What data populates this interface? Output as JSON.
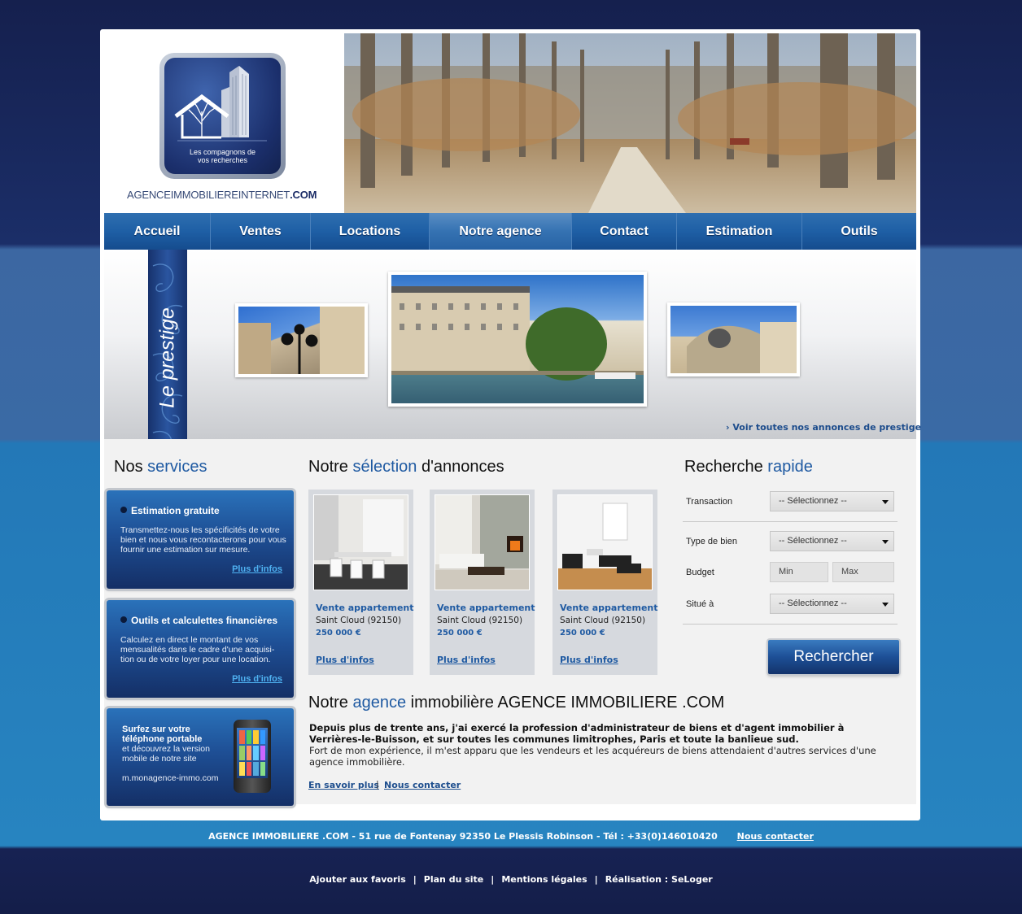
{
  "logo": {
    "tagline_line1": "Les compagnons de",
    "tagline_line2": "vos recherches",
    "site_name_part1": "AGENCEIMMOBILIEREINTERNET",
    "site_name_part2": ".COM"
  },
  "nav": {
    "items": [
      "Accueil",
      "Ventes",
      "Locations",
      "Notre agence",
      "Contact",
      "Estimation",
      "Outils"
    ],
    "active": "Notre agence"
  },
  "prestige": {
    "ribbon_label": "Le prestige",
    "link": "› Voir toutes nos annonces de prestige"
  },
  "services": {
    "title_part1": "Nos",
    "title_part2": "services",
    "items": [
      {
        "title": "Estimation gratuite",
        "text": "Transmettez-nous les spécificités de votre bien et nous vous recontacterons pour vous fournir une estimation sur mesure.",
        "link": "Plus d'infos"
      },
      {
        "title": "Outils et calculettes financières",
        "text": "Calculez en direct le montant de vos mensualités dans le cadre d'une acquisi-tion ou de votre loyer pour une location.",
        "link": "Plus d'infos"
      }
    ],
    "mobile": {
      "title_line1": "Surfez sur votre",
      "title_line2": "téléphone portable",
      "text_line1": "et découvrez la version",
      "text_line2": "mobile de notre site",
      "url": "m.monagence-immo.com"
    }
  },
  "selection": {
    "title_part1": "Notre",
    "title_part2": "sélection",
    "title_part3": "d'annonces",
    "cards": [
      {
        "title": "Vente appartement",
        "location": "Saint Cloud  (92150)",
        "price": "250 000 €",
        "link": "Plus d'infos"
      },
      {
        "title": "Vente appartement",
        "location": "Saint Cloud  (92150)",
        "price": "250 000 €",
        "link": "Plus d'infos"
      },
      {
        "title": "Vente appartement",
        "location": "Saint Cloud  (92150)",
        "price": "250 000 €",
        "link": "Plus d'infos"
      }
    ]
  },
  "search": {
    "title_part1": "Recherche",
    "title_part2": "rapide",
    "transaction_label": "Transaction",
    "transaction_value": "-- Sélectionnez --",
    "type_label": "Type de bien",
    "type_value": "-- Sélectionnez --",
    "budget_label": "Budget",
    "budget_min_placeholder": "Min",
    "budget_max_placeholder": "Max",
    "location_label": "Situé à",
    "location_value": "-- Sélectionnez --",
    "button": "Rechercher"
  },
  "agency": {
    "title_part1": "Notre",
    "title_part2": "agence",
    "title_part3": "immobilière AGENCE IMMOBILIERE .COM",
    "bold_text": "Depuis plus de trente ans, j'ai exercé la profession d'administrateur de biens et d'agent immobilier à Verrières-le-Buisson, et sur toutes les communes limitrophes, Paris et toute la banlieue sud.",
    "text": "Fort de mon expérience, il m'est apparu que les vendeurs et les acquéreurs de biens attendaient d'autres services d'une agence immobilière.",
    "link_more": "En savoir plus",
    "link_sep": "|",
    "link_contact": "Nous contacter"
  },
  "footer": {
    "address": "AGENCE IMMOBILIERE .COM  -  51 rue de Fontenay 92350 Le Plessis Robinson  -  Tél : +33(0)146010420",
    "contact_link": "Nous contacter",
    "links": [
      "Ajouter aux favoris",
      "Plan du site",
      "Mentions légales",
      "Réalisation : SeLoger"
    ],
    "sep": "|"
  },
  "colors": {
    "accent": "#1f5aa2",
    "nav": "#1e5fa5",
    "background": "#15204e",
    "link_light": "#4fb2f2"
  }
}
